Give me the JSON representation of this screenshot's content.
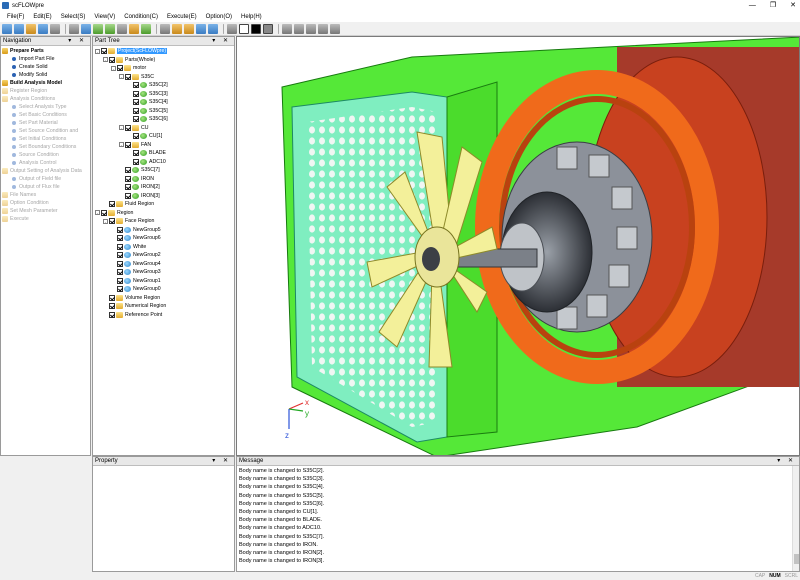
{
  "window": {
    "title": "scFLOWpre",
    "controls": [
      "—",
      "❐",
      "✕"
    ]
  },
  "menu": [
    "File(F)",
    "Edit(E)",
    "Select(S)",
    "View(V)",
    "Condition(C)",
    "Execute(E)",
    "Option(O)",
    "Help(H)"
  ],
  "toolbar": {
    "icons": [
      "select-icon",
      "undo-icon",
      "open-icon",
      "save-icon",
      "print-icon",
      "select-mode-icon",
      "rotate-icon",
      "zoom-icon",
      "fit-icon",
      "pan-icon",
      "pick-icon",
      "measure-icon",
      "section-icon",
      "lock-icon",
      "unlock-icon",
      "view-front-icon",
      "view-side-icon",
      "white-bg-icon",
      "black-bg-icon",
      "gray-bg-icon",
      "iso-view-icon",
      "top-view-icon",
      "right-view-icon",
      "left-view-icon",
      "bottom-view-icon",
      "back-view-icon"
    ]
  },
  "nav": {
    "title": "Navigation",
    "items": [
      {
        "label": "Prepare Parts",
        "level": 1,
        "state": "bold"
      },
      {
        "label": "Import Part File",
        "level": 2,
        "state": "normal"
      },
      {
        "label": "Create Solid",
        "level": 2,
        "state": "normal"
      },
      {
        "label": "Modify Solid",
        "level": 2,
        "state": "normal"
      },
      {
        "label": "Build Analysis Model",
        "level": 1,
        "state": "bold"
      },
      {
        "label": "Register Region",
        "level": 1,
        "state": "dim"
      },
      {
        "label": "Analysis Conditions",
        "level": 1,
        "state": "dim"
      },
      {
        "label": "Select Analysis Type",
        "level": 2,
        "state": "dim"
      },
      {
        "label": "Set Basic Conditions",
        "level": 2,
        "state": "dim"
      },
      {
        "label": "Set Part Material",
        "level": 2,
        "state": "dim"
      },
      {
        "label": "Set Source Condition and",
        "level": 2,
        "state": "dim"
      },
      {
        "label": "Set Initial Conditions",
        "level": 2,
        "state": "dim"
      },
      {
        "label": "Set Boundary Conditions",
        "level": 2,
        "state": "dim"
      },
      {
        "label": "Source Condition",
        "level": 2,
        "state": "dim"
      },
      {
        "label": "Analysis Control",
        "level": 2,
        "state": "dim"
      },
      {
        "label": "Output Setting of Analysis Data",
        "level": 1,
        "state": "dim"
      },
      {
        "label": "Output of Field file",
        "level": 2,
        "state": "dim"
      },
      {
        "label": "Output of Flux file",
        "level": 2,
        "state": "dim"
      },
      {
        "label": "File Names",
        "level": 1,
        "state": "dim"
      },
      {
        "label": "Option Condition",
        "level": 1,
        "state": "dim"
      },
      {
        "label": "Set Mesh Parameter",
        "level": 1,
        "state": "dim"
      },
      {
        "label": "Execute",
        "level": 1,
        "state": "dim"
      }
    ]
  },
  "tree": {
    "title": "Part Tree",
    "items": [
      {
        "label": "Project(ScFLOWpre)",
        "depth": 0,
        "exp": "-",
        "icon": "folder",
        "sel": true
      },
      {
        "label": "Parts(Whole)",
        "depth": 1,
        "exp": "-",
        "icon": "folder"
      },
      {
        "label": "motor",
        "depth": 2,
        "exp": "-",
        "icon": "folder"
      },
      {
        "label": "S35C",
        "depth": 3,
        "exp": "-",
        "icon": "folder"
      },
      {
        "label": "S35C[2]",
        "depth": 4,
        "exp": "",
        "icon": "body"
      },
      {
        "label": "S35C[3]",
        "depth": 4,
        "exp": "",
        "icon": "body"
      },
      {
        "label": "S35C[4]",
        "depth": 4,
        "exp": "",
        "icon": "body"
      },
      {
        "label": "S35C[5]",
        "depth": 4,
        "exp": "",
        "icon": "body"
      },
      {
        "label": "S35C[6]",
        "depth": 4,
        "exp": "",
        "icon": "body"
      },
      {
        "label": "CU",
        "depth": 3,
        "exp": "-",
        "icon": "folder"
      },
      {
        "label": "CU[1]",
        "depth": 4,
        "exp": "",
        "icon": "body"
      },
      {
        "label": "FAN",
        "depth": 3,
        "exp": "-",
        "icon": "folder"
      },
      {
        "label": "BLADE",
        "depth": 4,
        "exp": "",
        "icon": "body"
      },
      {
        "label": "ADC10",
        "depth": 4,
        "exp": "",
        "icon": "body"
      },
      {
        "label": "S35C[7]",
        "depth": 3,
        "exp": "",
        "icon": "body"
      },
      {
        "label": "IRON",
        "depth": 3,
        "exp": "",
        "icon": "body"
      },
      {
        "label": "IRON[2]",
        "depth": 3,
        "exp": "",
        "icon": "body"
      },
      {
        "label": "IRON[3]",
        "depth": 3,
        "exp": "",
        "icon": "body"
      },
      {
        "label": "Fluid Region",
        "depth": 1,
        "exp": "",
        "icon": "folder"
      },
      {
        "label": "Region",
        "depth": 0,
        "exp": "-",
        "icon": "folder"
      },
      {
        "label": "Face Region",
        "depth": 1,
        "exp": "-",
        "icon": "folder"
      },
      {
        "label": "NewGroup5",
        "depth": 2,
        "exp": "",
        "icon": "group"
      },
      {
        "label": "NewGroup6",
        "depth": 2,
        "exp": "",
        "icon": "group"
      },
      {
        "label": "White",
        "depth": 2,
        "exp": "",
        "icon": "group"
      },
      {
        "label": "NewGroup2",
        "depth": 2,
        "exp": "",
        "icon": "group"
      },
      {
        "label": "NewGroup4",
        "depth": 2,
        "exp": "",
        "icon": "group"
      },
      {
        "label": "NewGroup3",
        "depth": 2,
        "exp": "",
        "icon": "group"
      },
      {
        "label": "NewGroup1",
        "depth": 2,
        "exp": "",
        "icon": "group"
      },
      {
        "label": "NewGroup0",
        "depth": 2,
        "exp": "",
        "icon": "group"
      },
      {
        "label": "Volume Region",
        "depth": 1,
        "exp": "",
        "icon": "folder"
      },
      {
        "label": "Numerical Region",
        "depth": 1,
        "exp": "",
        "icon": "folder"
      },
      {
        "label": "Reference Point",
        "depth": 1,
        "exp": "",
        "icon": "folder"
      }
    ]
  },
  "viewport": {
    "axes": {
      "x": "x",
      "y": "y",
      "z": "z"
    }
  },
  "property": {
    "title": "Property"
  },
  "message": {
    "title": "Message",
    "lines": [
      "Body name is changed to S35C[2].",
      "Body name is changed to S35C[3].",
      "Body name is changed to S35C[4].",
      "Body name is changed to S35C[5].",
      "Body name is changed to S35C[6].",
      "Body name is changed to CU[1].",
      "Body name is changed to BLADE.",
      "Body name is changed to ADC10.",
      "Body name is changed to S35C[7].",
      "Body name is changed to IRON.",
      "Body name is changed to IRON[2].",
      "Body name is changed to IRON[3]."
    ]
  },
  "panel_buttons": "▾ ✕",
  "status": {
    "cap": "CAP",
    "num": "NUM",
    "scrl": "SCRL"
  }
}
